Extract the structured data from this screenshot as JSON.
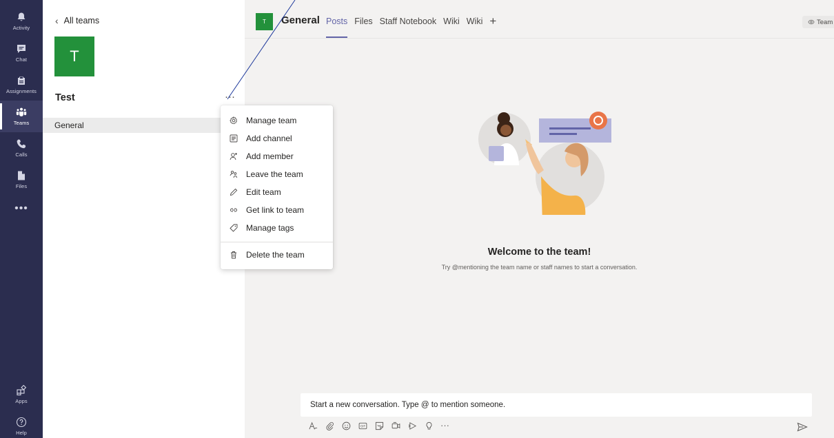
{
  "rail": {
    "items": [
      {
        "label": "Activity",
        "icon": "bell-icon"
      },
      {
        "label": "Chat",
        "icon": "chat-icon"
      },
      {
        "label": "Assignments",
        "icon": "assignments-icon"
      },
      {
        "label": "Teams",
        "icon": "teams-icon",
        "active": true
      },
      {
        "label": "Calls",
        "icon": "phone-icon"
      },
      {
        "label": "Files",
        "icon": "file-icon"
      }
    ],
    "more": "•••",
    "bottom": [
      {
        "label": "Apps",
        "icon": "apps-icon"
      },
      {
        "label": "Help",
        "icon": "help-icon"
      }
    ]
  },
  "team_panel": {
    "back_label": "All teams",
    "avatar_letter": "T",
    "team_name": "Test",
    "more_label": "···",
    "channels": [
      "General"
    ]
  },
  "header": {
    "avatar_letter": "T",
    "channel_name": "General",
    "tabs": [
      {
        "label": "Posts",
        "active": true
      },
      {
        "label": "Files"
      },
      {
        "label": "Staff Notebook"
      },
      {
        "label": "Wiki"
      },
      {
        "label": "Wiki"
      }
    ],
    "add_tab": "+",
    "team_button": "Team"
  },
  "welcome": {
    "title": "Welcome to the team!",
    "subtitle": "Try @mentioning the team name or staff names to start a conversation."
  },
  "compose": {
    "placeholder": "Start a new conversation. Type @ to mention someone.",
    "toolbar_more": "···"
  },
  "menu": {
    "items": [
      {
        "label": "Manage team",
        "icon": "gear-icon"
      },
      {
        "label": "Add channel",
        "icon": "add-channel-icon"
      },
      {
        "label": "Add member",
        "icon": "add-member-icon"
      },
      {
        "label": "Leave the team",
        "icon": "leave-icon"
      },
      {
        "label": "Edit team",
        "icon": "pencil-icon"
      },
      {
        "label": "Get link to team",
        "icon": "link-icon"
      },
      {
        "label": "Manage tags",
        "icon": "tag-icon"
      }
    ],
    "danger_item": {
      "label": "Delete the team",
      "icon": "trash-icon"
    }
  },
  "colors": {
    "rail_bg": "#2b2d4f",
    "accent": "#6264a7",
    "team_avatar": "#23913b",
    "main_bg": "#f3f2f1"
  }
}
